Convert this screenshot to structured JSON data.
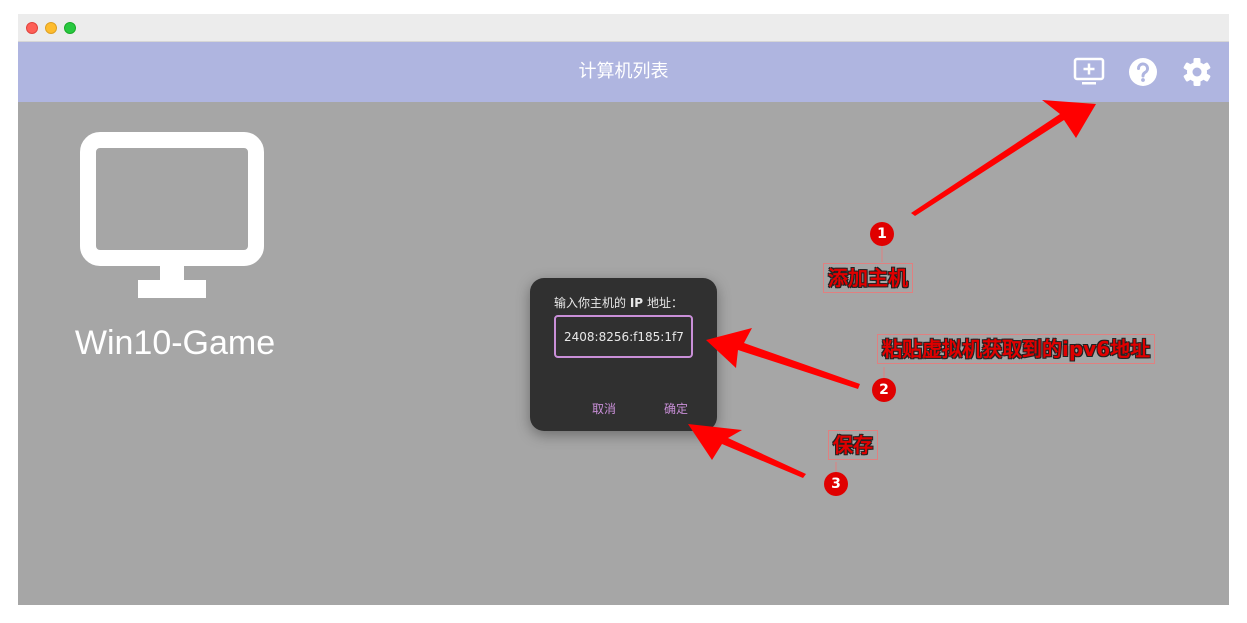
{
  "header": {
    "title": "计算机列表",
    "icons": [
      "add-computer-icon",
      "help-icon",
      "settings-icon"
    ]
  },
  "computers": [
    {
      "name": "Win10-Game",
      "icon": "monitor-icon"
    }
  ],
  "dialog": {
    "title_prefix": "输入你主机的",
    "title_bold": "IP",
    "title_suffix": "地址：",
    "input_value": "2408:8256:f185:1f7",
    "cancel_label": "取消",
    "ok_label": "确定",
    "accent_color": "#c98fd8"
  },
  "annotations": [
    {
      "number": "1",
      "label": "添加主机"
    },
    {
      "number": "2",
      "label": "粘贴虚拟机获取到的ipv6地址"
    },
    {
      "number": "3",
      "label": "保存"
    }
  ],
  "colors": {
    "appbar": "#afb5e0",
    "content_background": "#a6a6a6",
    "dialog_background": "#303030",
    "annotation_red": "#e00000"
  }
}
